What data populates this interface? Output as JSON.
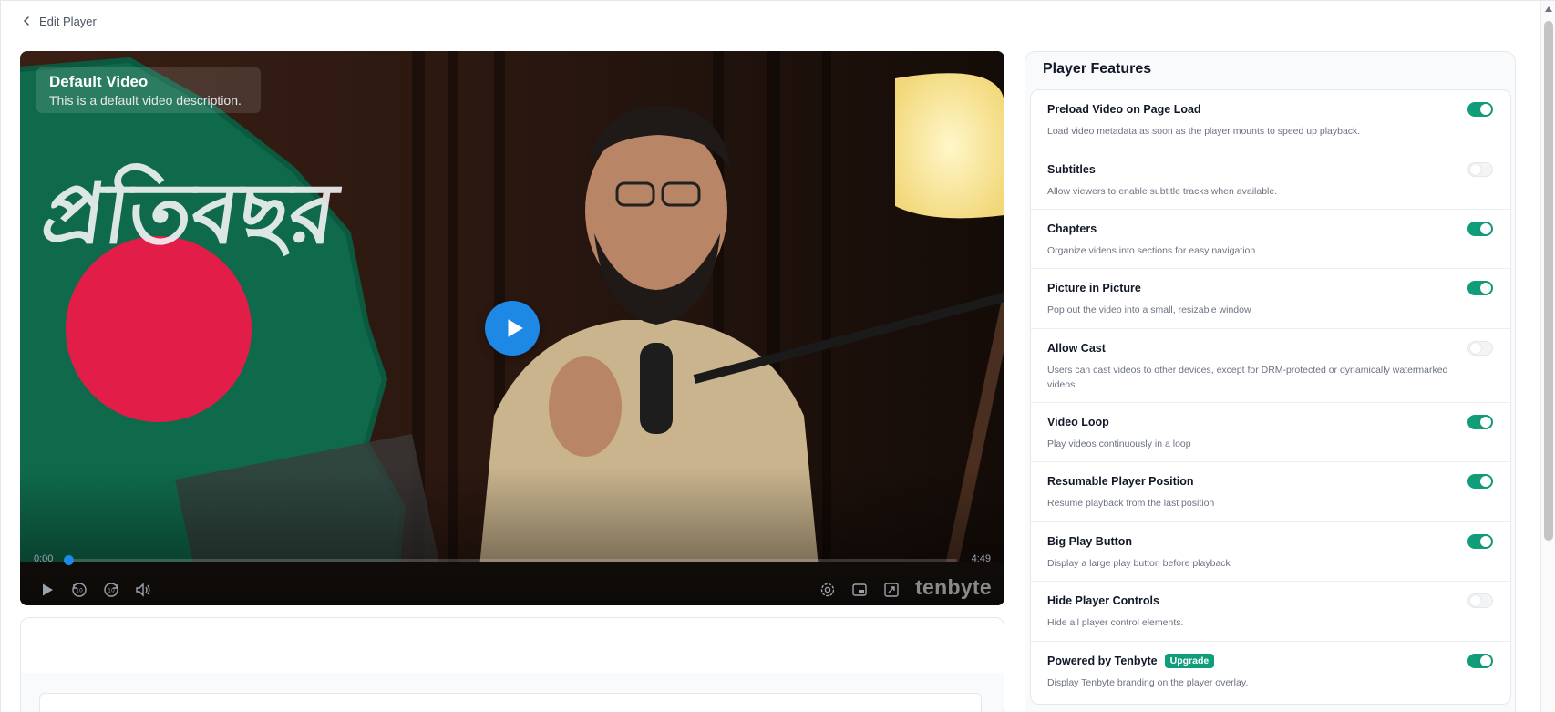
{
  "header": {
    "back_label": "Edit Player"
  },
  "player": {
    "video_title": "Default Video",
    "video_description": "This is a default video description.",
    "current_time": "0:00",
    "duration": "4:49",
    "brand": "tenbyte",
    "accent_color": "#1e88e5",
    "progress_fraction": 0
  },
  "features": {
    "title": "Player Features",
    "toggle_on_color": "#0f9d7a",
    "items": [
      {
        "label": "Preload Video on Page Load",
        "description": "Load video metadata as soon as the player mounts to speed up playback.",
        "enabled": true
      },
      {
        "label": "Subtitles",
        "description": "Allow viewers to enable subtitle tracks when available.",
        "enabled": false
      },
      {
        "label": "Chapters",
        "description": "Organize videos into sections for easy navigation",
        "enabled": true
      },
      {
        "label": "Picture in Picture",
        "description": "Pop out the video into a small, resizable window",
        "enabled": true
      },
      {
        "label": "Allow Cast",
        "description": "Users can cast videos to other devices, except for DRM-protected or dynamically watermarked videos",
        "enabled": false
      },
      {
        "label": "Video Loop",
        "description": "Play videos continuously in a loop",
        "enabled": true
      },
      {
        "label": "Resumable Player Position",
        "description": "Resume playback from the last position",
        "enabled": true
      },
      {
        "label": "Big Play Button",
        "description": "Display a large play button before playback",
        "enabled": true
      },
      {
        "label": "Hide Player Controls",
        "description": "Hide all player control elements.",
        "enabled": false
      },
      {
        "label": "Powered by Tenbyte",
        "badge": "Upgrade",
        "description": "Display Tenbyte branding on the player overlay.",
        "enabled": true
      }
    ]
  }
}
